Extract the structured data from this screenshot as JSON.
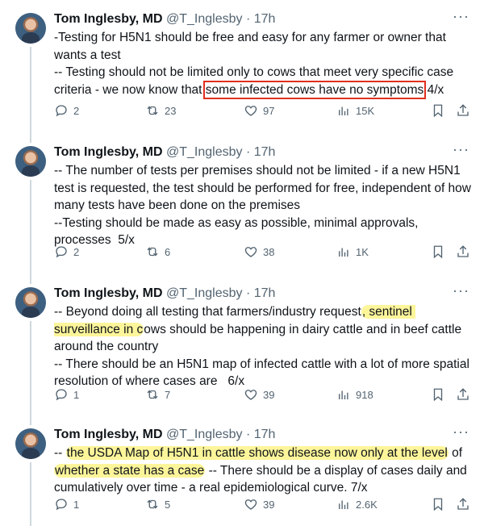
{
  "author": {
    "name": "Tom Inglesby, MD",
    "handle": "@T_Inglesby",
    "time": "17h"
  },
  "tweets": [
    {
      "parts": [
        "-Testing for H5N1 should be free and easy for any farmer or owner that wants a test\n-- Testing should not be limited only to cows that meet very specific case criteria - we now know that ",
        "some infected cows have no symptoms",
        " 4/x"
      ],
      "replies": "2",
      "reposts": "23",
      "likes": "97",
      "views": "15K"
    },
    {
      "parts": [
        "-- The number of tests per premises should not be limited - if a new H5N1 test is requested, the test should be performed for free, independent of how many tests have been done on the premises\n--Testing should be made as easy as possible, minimal approvals, processes  5/x"
      ],
      "replies": "2",
      "reposts": "6",
      "likes": "38",
      "views": "1K"
    },
    {
      "parts": [
        "-- Beyond doing all testing that farmers/industry request",
        ", sentinel surveillance in c",
        "ows should be happening in dairy cattle and in beef cattle around the country\n-- There should be an H5N1 map of infected cattle with a lot of more spatial resolution of where cases are   6/x"
      ],
      "replies": "1",
      "reposts": "7",
      "likes": "39",
      "views": "918"
    },
    {
      "parts": [
        "-- ",
        "the USDA Map of H5N1 in cattle shows disease now only at the level",
        " of ",
        "whether a state has a case",
        " -- There should be a display of cases daily and cumulatively over time - a real epidemiological curve. 7/x"
      ],
      "replies": "1",
      "reposts": "5",
      "likes": "39",
      "views": "2.6K"
    }
  ],
  "colors": {
    "highlight": "#fdf59a",
    "box": "#e0301e",
    "muted": "#536471"
  }
}
